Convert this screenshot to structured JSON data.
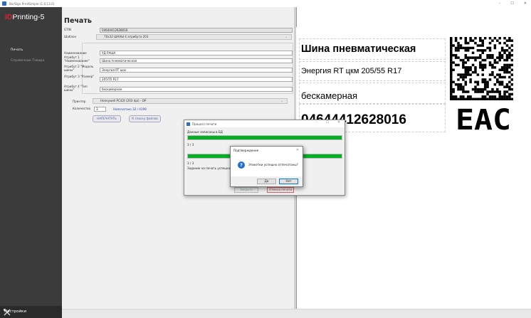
{
  "window": {
    "title": "BarSign PrintSimple (1.0.13.0)",
    "controls": {
      "minimize": "–",
      "maximize": "☐",
      "close": "✕"
    }
  },
  "sidebar": {
    "logo": {
      "id": "ID",
      "label": "LABEL",
      "rest": "Printing-5"
    },
    "items": [
      {
        "label": "Печать",
        "active": true
      },
      {
        "label": "Справочник Товара",
        "active": false
      }
    ],
    "settings_label": "Настройки"
  },
  "form": {
    "title": "Печать",
    "gtin": {
      "label": "GTIN",
      "value": "04644412628016"
    },
    "template": {
      "label": "Шаблон",
      "value": "70x32 ШАНЫ 4 атрибута 203"
    },
    "name": {
      "label": "Наименование",
      "value": "УД РАША"
    },
    "attr1": {
      "label": "Атрибут 1 \"Наименование\"",
      "value": "Шина пневматическая"
    },
    "attr2": {
      "label": "Атрибут 2 \"Модель шины\"",
      "value": "Энергия RT цкм"
    },
    "attr3": {
      "label": "Атрибут 3 \"Размер\"",
      "value": "205/55 R17"
    },
    "attr4": {
      "label": "Атрибут 4 \"Тип шины\"",
      "value": "бескамерная"
    },
    "printer": {
      "label": "Принтер",
      "value": "Honeywell PC42t (203 dpi) - DP"
    },
    "quantity": {
      "label": "Количество",
      "value": "3"
    },
    "printed_info": "Напечатано 32 / 4199",
    "print_button": "НАПЕЧАТАТЬ",
    "files_button": "К списку файлов"
  },
  "label_preview": {
    "line1": "Шина пневматическая",
    "line2": "Энергия RT цкм 205/55 R17",
    "line3": "бескамерная",
    "line4": "04644412628016",
    "mark": "EAC"
  },
  "progress_window": {
    "title": "Процесс печати",
    "saved_label": "Данные записаны в БД",
    "bar1_fraction": 1.0,
    "count1": "3 / 3",
    "bar2_fraction": 1.0,
    "count2": "3 / 3",
    "status": "Задание на печать успешно",
    "close_button": "Закрыть",
    "cancel_button": "Отмена печати"
  },
  "confirm_dialog": {
    "title": "Подтверждение",
    "message": "Этикетки успешно отпечатаны?",
    "yes": "Да",
    "no": "Нет"
  },
  "colors": {
    "sidebar": "#3b3b3b",
    "logo_accent": "#d6232d",
    "progress_fill": "#06b025",
    "link": "#1a3fb0"
  }
}
